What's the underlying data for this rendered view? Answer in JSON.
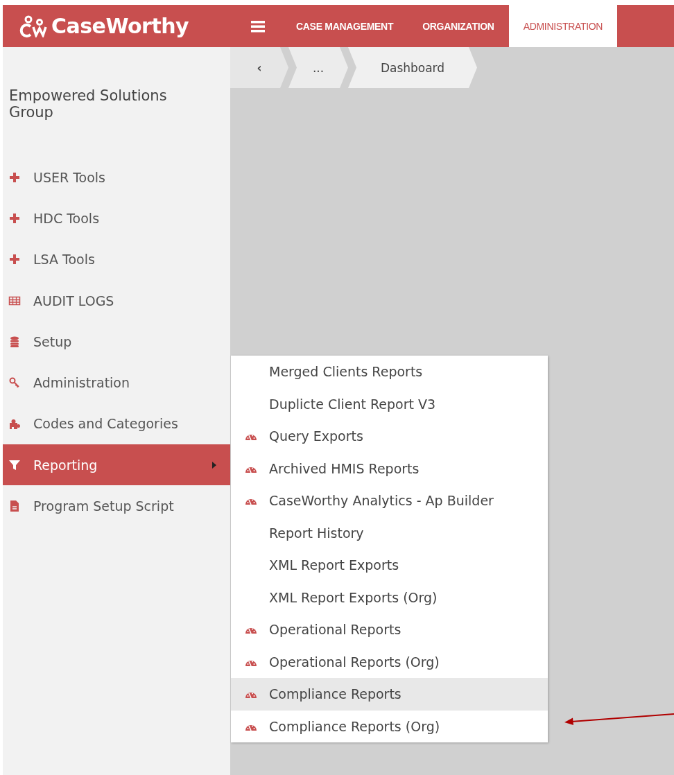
{
  "header": {
    "logo": "CaseWorthy",
    "tabs": [
      {
        "label": "CASE MANAGEMENT",
        "selected": false
      },
      {
        "label": "ORGANIZATION",
        "selected": false
      },
      {
        "label": "ADMINISTRATION",
        "selected": true
      }
    ]
  },
  "breadcrumb": [
    {
      "label": "‹",
      "kind": "back"
    },
    {
      "label": "...",
      "kind": "more"
    },
    {
      "label": "Dashboard",
      "kind": "page"
    }
  ],
  "sidebar": {
    "title": "Empowered Solutions Group",
    "items": [
      {
        "label": "USER Tools",
        "kind": "plus",
        "selected": false
      },
      {
        "label": "HDC Tools",
        "kind": "plus",
        "selected": false
      },
      {
        "label": "LSA Tools",
        "kind": "plus",
        "selected": false
      },
      {
        "label": "AUDIT LOGS",
        "kind": "table",
        "selected": false
      },
      {
        "label": "Setup",
        "kind": "database",
        "selected": false
      },
      {
        "label": "Administration",
        "kind": "key",
        "selected": false
      },
      {
        "label": "Codes and Categories",
        "kind": "puzzle",
        "selected": false
      },
      {
        "label": "Reporting",
        "kind": "filter",
        "selected": true
      },
      {
        "label": "Program Setup Script",
        "kind": "file",
        "selected": false
      }
    ]
  },
  "submenu": [
    {
      "label": "Merged Clients Reports",
      "kind": "plain",
      "highlighted": false
    },
    {
      "label": "Duplicte Client Report V3",
      "kind": "plain",
      "highlighted": false
    },
    {
      "label": "Query Exports",
      "kind": "dashboard",
      "highlighted": false
    },
    {
      "label": "Archived HMIS Reports",
      "kind": "dashboard",
      "highlighted": false
    },
    {
      "label": "CaseWorthy Analytics - Ap Builder",
      "kind": "dashboard",
      "highlighted": false
    },
    {
      "label": "Report History",
      "kind": "plain",
      "highlighted": false
    },
    {
      "label": "XML Report Exports",
      "kind": "plain",
      "highlighted": false
    },
    {
      "label": "XML Report Exports (Org)",
      "kind": "plain",
      "highlighted": false
    },
    {
      "label": "Operational Reports",
      "kind": "dashboard",
      "highlighted": false
    },
    {
      "label": "Operational Reports (Org)",
      "kind": "dashboard",
      "highlighted": false
    },
    {
      "label": "Compliance Reports",
      "kind": "dashboard",
      "highlighted": true
    },
    {
      "label": "Compliance Reports (Org)",
      "kind": "dashboard",
      "highlighted": false
    }
  ]
}
